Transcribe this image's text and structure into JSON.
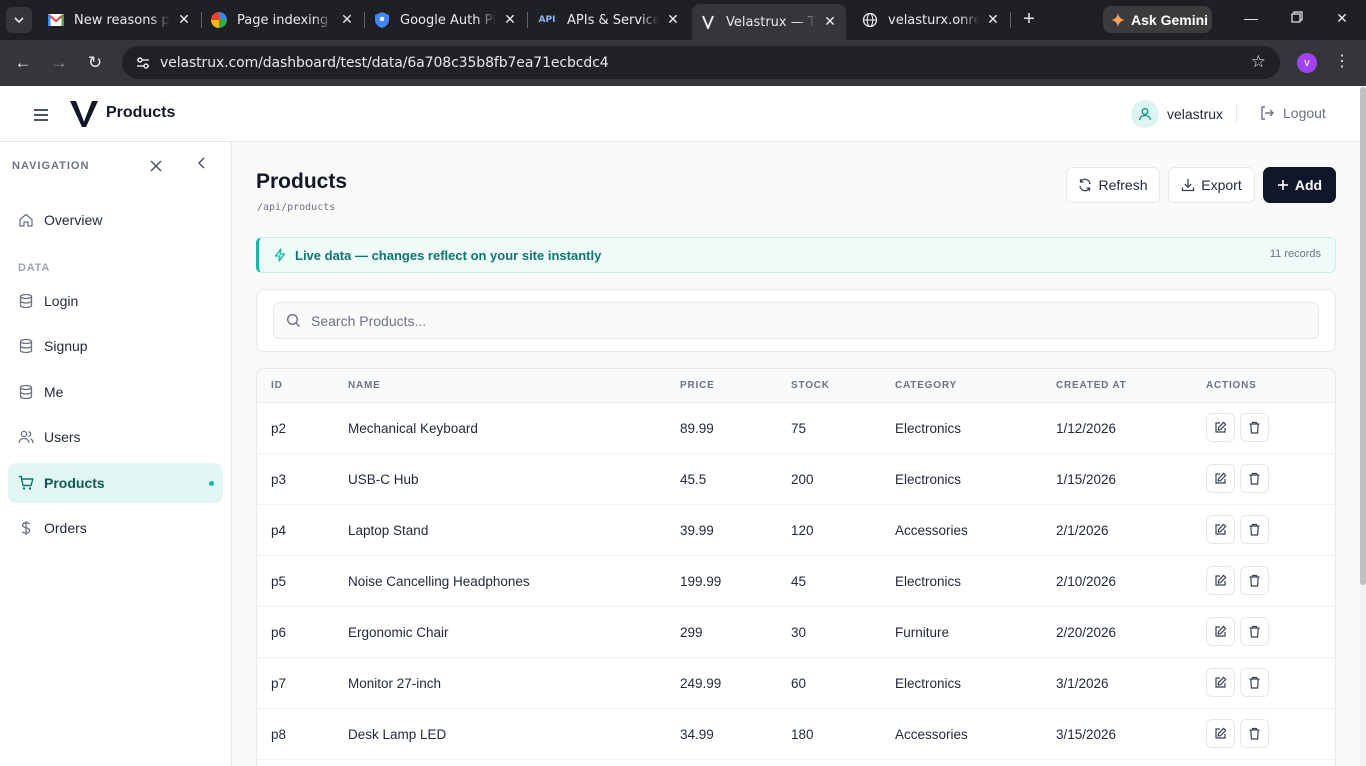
{
  "browser": {
    "tabs": [
      {
        "title": "New reasons pre",
        "favicon": "gmail-icon"
      },
      {
        "title": "Page indexing",
        "favicon": "search-console-icon"
      },
      {
        "title": "Google Auth Plat",
        "favicon": "shield-icon"
      },
      {
        "title": "APIs & Services –",
        "favicon": "api-icon"
      },
      {
        "title": "Velastrux — Turn",
        "favicon": "velastrux-icon"
      },
      {
        "title": "velasturx.onrende",
        "favicon": "globe-icon"
      }
    ],
    "active_tab": 4,
    "api_favicon_text": "API",
    "ask_gemini": "Ask Gemini",
    "url": "velastrux.com/dashboard/test/data/6a708c35b8fb7ea71ecbcdc4",
    "profile_initial": "v"
  },
  "header": {
    "brand": "Products",
    "username": "velastrux",
    "logout": "Logout"
  },
  "sidebar": {
    "heading": "NAVIGATION",
    "section_label": "DATA",
    "items": [
      {
        "label": "Overview",
        "icon": "home-icon"
      },
      {
        "label": "Login",
        "icon": "database-icon"
      },
      {
        "label": "Signup",
        "icon": "database-icon"
      },
      {
        "label": "Me",
        "icon": "database-icon"
      },
      {
        "label": "Users",
        "icon": "users-icon"
      },
      {
        "label": "Products",
        "icon": "cart-icon",
        "active": true
      },
      {
        "label": "Orders",
        "icon": "dollar-icon"
      }
    ]
  },
  "main": {
    "title": "Products",
    "endpoint": "/api/products",
    "refresh": "Refresh",
    "export": "Export",
    "add": "Add",
    "live_text": "Live data — changes reflect on your site instantly",
    "records": "11 records",
    "search_placeholder": "Search Products...",
    "columns": [
      "ID",
      "NAME",
      "PRICE",
      "STOCK",
      "CATEGORY",
      "CREATED AT",
      "ACTIONS"
    ],
    "rows": [
      {
        "id": "p2",
        "name": "Mechanical Keyboard",
        "price": "89.99",
        "stock": "75",
        "category": "Electronics",
        "created": "1/12/2026"
      },
      {
        "id": "p3",
        "name": "USB-C Hub",
        "price": "45.5",
        "stock": "200",
        "category": "Electronics",
        "created": "1/15/2026"
      },
      {
        "id": "p4",
        "name": "Laptop Stand",
        "price": "39.99",
        "stock": "120",
        "category": "Accessories",
        "created": "2/1/2026"
      },
      {
        "id": "p5",
        "name": "Noise Cancelling Headphones",
        "price": "199.99",
        "stock": "45",
        "category": "Electronics",
        "created": "2/10/2026"
      },
      {
        "id": "p6",
        "name": "Ergonomic Chair",
        "price": "299",
        "stock": "30",
        "category": "Furniture",
        "created": "2/20/2026"
      },
      {
        "id": "p7",
        "name": "Monitor 27-inch",
        "price": "249.99",
        "stock": "60",
        "category": "Electronics",
        "created": "3/1/2026"
      },
      {
        "id": "p8",
        "name": "Desk Lamp LED",
        "price": "34.99",
        "stock": "180",
        "category": "Accessories",
        "created": "3/15/2026"
      }
    ]
  },
  "colors": {
    "accent": "#14b8a6",
    "active_bg": "#e2f6f3",
    "primary_button": "#0f172a"
  }
}
